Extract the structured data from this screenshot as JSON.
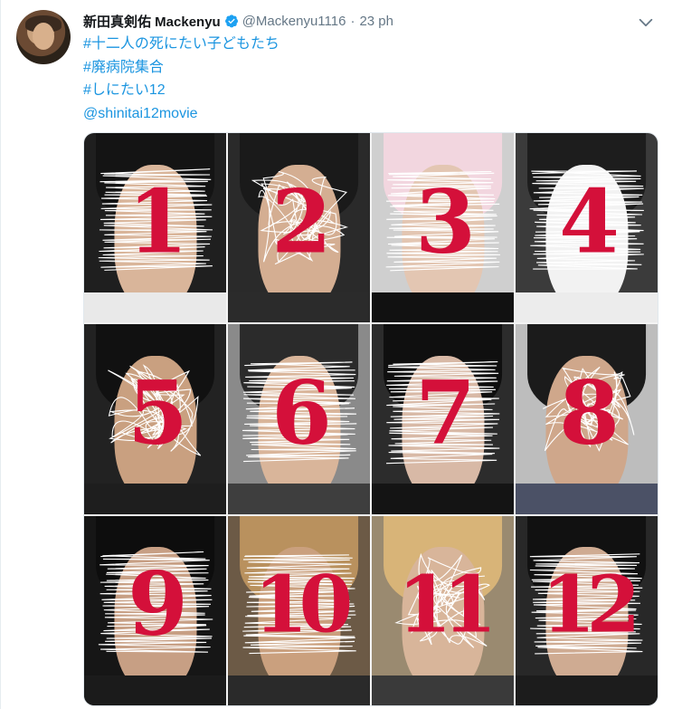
{
  "tweet": {
    "author_name": "新田真剣佑 Mackenyu",
    "handle": "@Mackenyu1116",
    "separator": "·",
    "time": "23 ph",
    "lines": [
      "#十二人の死にたい子どもたち",
      "#廃病院集合",
      "#しにたい12",
      "@shinitai12movie"
    ]
  },
  "media": {
    "tiles": [
      "1",
      "2",
      "3",
      "4",
      "5",
      "6",
      "7",
      "8",
      "9",
      "10",
      "11",
      "12"
    ],
    "number_color": "#d4103a"
  },
  "colors": {
    "link": "#1b95e0",
    "verified": "#1da1f2",
    "muted": "#657786"
  },
  "icons": {
    "verified": "verified-badge-icon",
    "caret": "chevron-down-icon"
  }
}
